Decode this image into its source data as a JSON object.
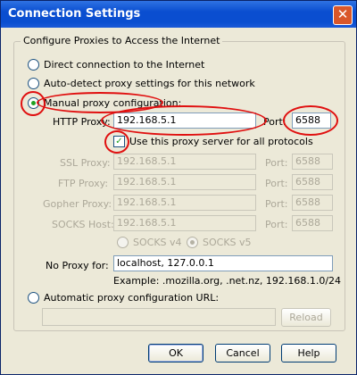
{
  "window": {
    "title": "Connection Settings",
    "close_glyph": "✕"
  },
  "group_title": "Configure Proxies to Access the Internet",
  "radios": {
    "direct": "Direct connection to the Internet",
    "auto_detect": "Auto-detect proxy settings for this network",
    "manual": "Manual proxy configuration:",
    "auto_url": "Automatic proxy configuration URL:"
  },
  "http": {
    "label": "HTTP Proxy:",
    "value": "192.168.5.1",
    "port_label": "Port:",
    "port": "6588"
  },
  "use_for_all": "Use this proxy server for all protocols",
  "other_proxies": [
    {
      "label": "SSL Proxy:",
      "value": "192.168.5.1",
      "port_label": "Port:",
      "port": "6588"
    },
    {
      "label": "FTP Proxy:",
      "value": "192.168.5.1",
      "port_label": "Port:",
      "port": "6588"
    },
    {
      "label": "Gopher Proxy:",
      "value": "192.168.5.1",
      "port_label": "Port:",
      "port": "6588"
    },
    {
      "label": "SOCKS Host:",
      "value": "192.168.5.1",
      "port_label": "Port:",
      "port": "6588"
    }
  ],
  "socks": {
    "v4": "SOCKS v4",
    "v5": "SOCKS v5"
  },
  "no_proxy": {
    "label": "No Proxy for:",
    "value": "localhost, 127.0.0.1",
    "example": "Example: .mozilla.org, .net.nz, 192.168.1.0/24"
  },
  "auto_url_value": "",
  "buttons": {
    "reload": "Reload",
    "ok": "OK",
    "cancel": "Cancel",
    "help": "Help"
  },
  "colors": {
    "annotation": "#e01010",
    "titlebar": "#0a4ed0",
    "check": "#20a020"
  }
}
